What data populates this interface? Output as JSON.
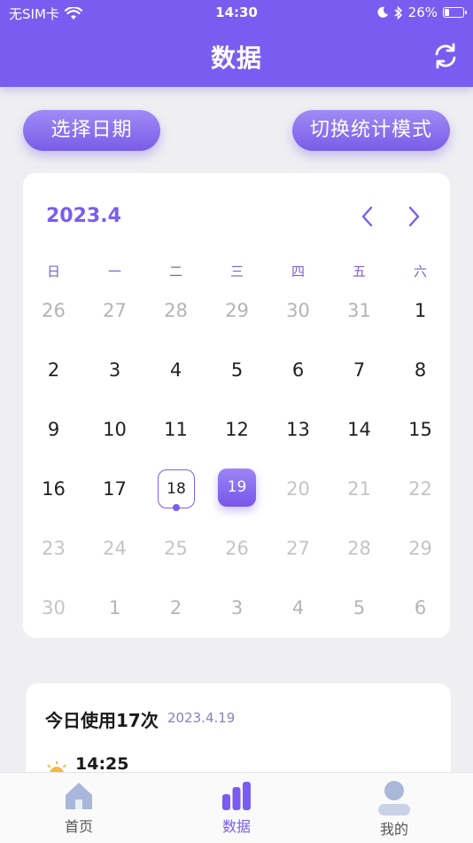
{
  "status_bar": {
    "carrier": "无SIM卡",
    "time": "14:30",
    "battery": "26%",
    "battery_level": 0.26
  },
  "header": {
    "title": "数据"
  },
  "buttons": {
    "select_date": "选择日期",
    "switch_mode": "切换统计模式"
  },
  "calendar": {
    "month": "2023.4",
    "weekdays": [
      "日",
      "一",
      "二",
      "三",
      "四",
      "五",
      "六"
    ],
    "weeks": [
      [
        {
          "d": "26",
          "t": "other"
        },
        {
          "d": "27",
          "t": "other"
        },
        {
          "d": "28",
          "t": "other"
        },
        {
          "d": "29",
          "t": "other"
        },
        {
          "d": "30",
          "t": "other"
        },
        {
          "d": "31",
          "t": "other"
        },
        {
          "d": "1",
          "t": "cur"
        }
      ],
      [
        {
          "d": "2",
          "t": "cur"
        },
        {
          "d": "3",
          "t": "cur"
        },
        {
          "d": "4",
          "t": "cur"
        },
        {
          "d": "5",
          "t": "cur"
        },
        {
          "d": "6",
          "t": "cur"
        },
        {
          "d": "7",
          "t": "cur"
        },
        {
          "d": "8",
          "t": "cur"
        }
      ],
      [
        {
          "d": "9",
          "t": "cur"
        },
        {
          "d": "10",
          "t": "cur"
        },
        {
          "d": "11",
          "t": "cur"
        },
        {
          "d": "12",
          "t": "cur"
        },
        {
          "d": "13",
          "t": "cur"
        },
        {
          "d": "14",
          "t": "cur"
        },
        {
          "d": "15",
          "t": "cur"
        }
      ],
      [
        {
          "d": "16",
          "t": "cur"
        },
        {
          "d": "17",
          "t": "cur"
        },
        {
          "d": "18",
          "t": "today"
        },
        {
          "d": "19",
          "t": "selected"
        },
        {
          "d": "20",
          "t": "future"
        },
        {
          "d": "21",
          "t": "future"
        },
        {
          "d": "22",
          "t": "future"
        }
      ],
      [
        {
          "d": "23",
          "t": "future"
        },
        {
          "d": "24",
          "t": "future"
        },
        {
          "d": "25",
          "t": "future"
        },
        {
          "d": "26",
          "t": "future"
        },
        {
          "d": "27",
          "t": "future"
        },
        {
          "d": "28",
          "t": "future"
        },
        {
          "d": "29",
          "t": "future"
        }
      ],
      [
        {
          "d": "30",
          "t": "future"
        },
        {
          "d": "1",
          "t": "other"
        },
        {
          "d": "2",
          "t": "other"
        },
        {
          "d": "3",
          "t": "other"
        },
        {
          "d": "4",
          "t": "other"
        },
        {
          "d": "5",
          "t": "other"
        },
        {
          "d": "6",
          "t": "other"
        }
      ]
    ]
  },
  "usage": {
    "title": "今日使用17次",
    "date": "2023.4.19",
    "first_entry_time": "14:25"
  },
  "tabbar": {
    "items": [
      {
        "label": "首页",
        "icon": "home-icon"
      },
      {
        "label": "数据",
        "icon": "bar-chart-icon"
      },
      {
        "label": "我的",
        "icon": "user-icon"
      }
    ],
    "active_index": 1
  },
  "colors": {
    "accent": "#7b5cf0",
    "background": "#efeff2"
  }
}
